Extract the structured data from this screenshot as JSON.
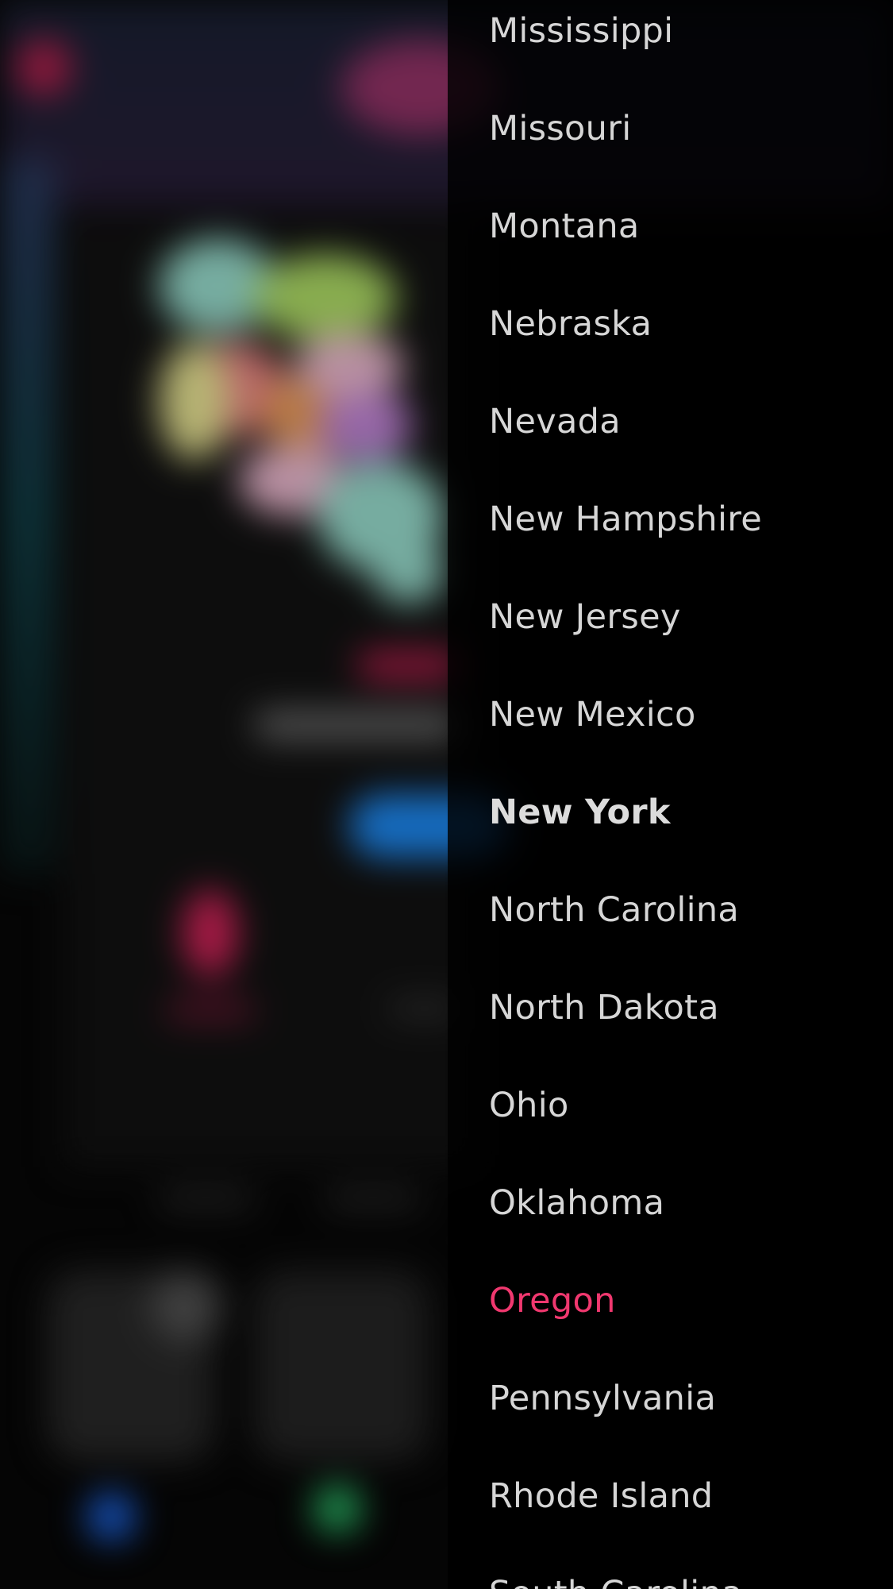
{
  "picker": {
    "options": [
      {
        "label": "Mississippi",
        "state": "normal"
      },
      {
        "label": "Missouri",
        "state": "normal"
      },
      {
        "label": "Montana",
        "state": "normal"
      },
      {
        "label": "Nebraska",
        "state": "normal"
      },
      {
        "label": "Nevada",
        "state": "normal"
      },
      {
        "label": "New Hampshire",
        "state": "normal"
      },
      {
        "label": "New Jersey",
        "state": "normal"
      },
      {
        "label": "New Mexico",
        "state": "normal"
      },
      {
        "label": "New York",
        "state": "current"
      },
      {
        "label": "North Carolina",
        "state": "normal"
      },
      {
        "label": "North Dakota",
        "state": "normal"
      },
      {
        "label": "Ohio",
        "state": "normal"
      },
      {
        "label": "Oklahoma",
        "state": "normal"
      },
      {
        "label": "Oregon",
        "state": "highlighted"
      },
      {
        "label": "Pennsylvania",
        "state": "normal"
      },
      {
        "label": "Rhode Island",
        "state": "normal"
      },
      {
        "label": "South Carolina",
        "state": "normal"
      }
    ],
    "colors": {
      "text": "#d6d6d6",
      "highlight": "#f0386f",
      "panel": "#000000"
    }
  },
  "background": {
    "colors": {
      "accent_pink": "#e0245e",
      "accent_blue": "#1e90ff",
      "accent_green": "#2ecc71",
      "map_colors": [
        "#9ee6d6",
        "#b6e66a",
        "#f48a8a",
        "#f5a35b",
        "#c98ae0",
        "#f6c0d8",
        "#f3ef9a",
        "#d8d8d8"
      ]
    }
  }
}
